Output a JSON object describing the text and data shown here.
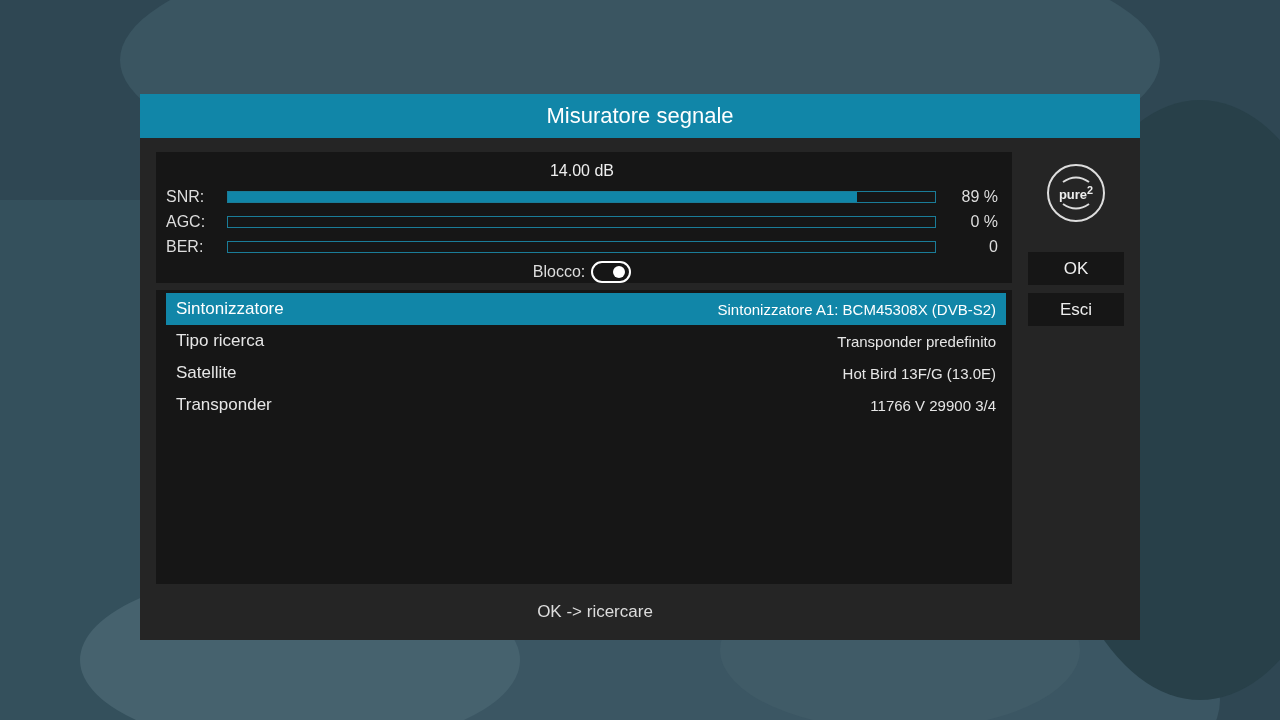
{
  "dialog": {
    "title": "Misuratore segnale"
  },
  "signal": {
    "reading": "14.00 dB",
    "meters": [
      {
        "label": "SNR:",
        "level": 0.89,
        "reading": "89 %"
      },
      {
        "label": "AGC:",
        "level": 0,
        "reading": "0 %"
      },
      {
        "label": "BER:",
        "level": 0,
        "reading": "0"
      }
    ],
    "lock": {
      "label": "Blocco:",
      "on": true
    }
  },
  "settings": [
    {
      "label": "Sintonizzatore",
      "value": "Sintonizzatore A1: BCM45308X (DVB-S2)",
      "selected": true
    },
    {
      "label": "Tipo ricerca",
      "value": "Transponder predefinito",
      "selected": false
    },
    {
      "label": "Satellite",
      "value": "Hot Bird 13F/G (13.0E)",
      "selected": false
    },
    {
      "label": "Transponder",
      "value": "11766 V 29900 3/4",
      "selected": false
    }
  ],
  "logo": {
    "text": "pure$^{2}$"
  },
  "buttons": [
    "OK",
    "Esci"
  ],
  "hint": "OK -> ricercare"
}
